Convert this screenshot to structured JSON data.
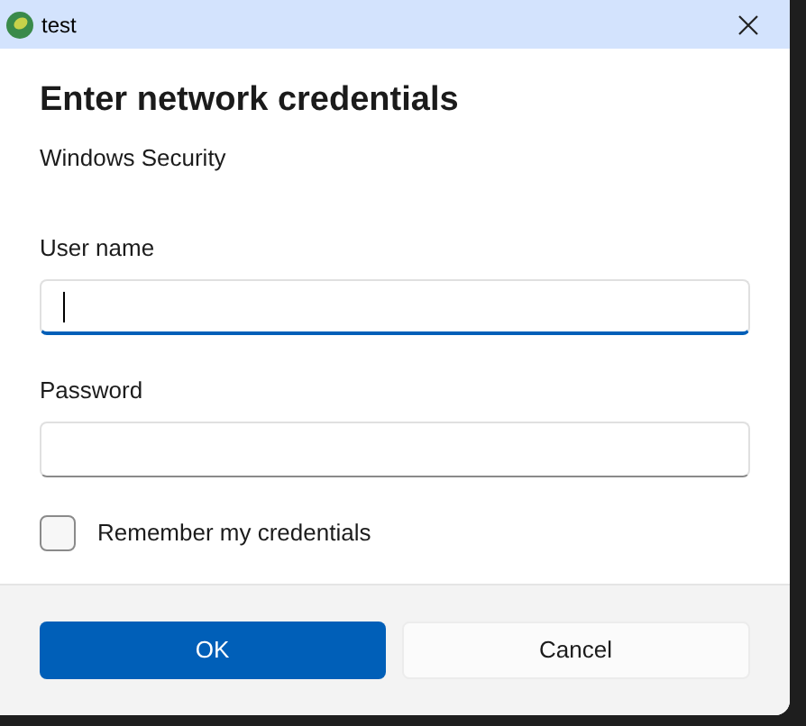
{
  "window": {
    "title": "test"
  },
  "dialog": {
    "heading": "Enter network credentials",
    "subtitle": "Windows Security"
  },
  "fields": [
    {
      "label": "User name",
      "focused": true
    },
    {
      "label": "Password",
      "focused": false
    }
  ],
  "remember": {
    "label": "Remember my credentials",
    "checked": false
  },
  "buttons": [
    {
      "label": "OK",
      "primary": true
    },
    {
      "label": "Cancel",
      "primary": false
    }
  ]
}
